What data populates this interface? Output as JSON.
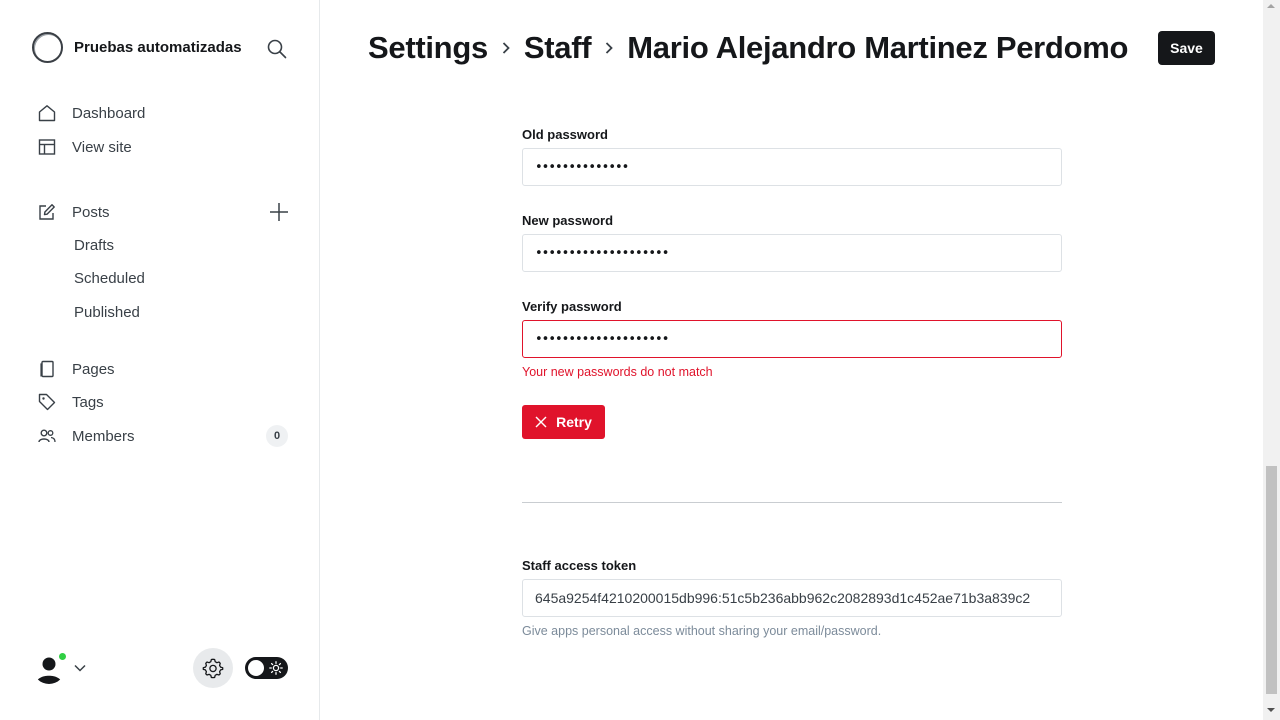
{
  "sidebar": {
    "site_name": "Pruebas automatizadas",
    "nav": {
      "dashboard": "Dashboard",
      "view_site": "View site",
      "posts": "Posts",
      "drafts": "Drafts",
      "scheduled": "Scheduled",
      "published": "Published",
      "pages": "Pages",
      "tags": "Tags",
      "members": "Members",
      "members_count": "0"
    },
    "icons": [
      "search-icon",
      "home-icon",
      "layout-icon",
      "pencil-icon",
      "plus-icon",
      "page-icon",
      "tag-icon",
      "members-icon",
      "gear-icon",
      "sun-icon",
      "chevron-down-icon"
    ]
  },
  "header": {
    "crumbs": [
      "Settings",
      "Staff",
      "Mario Alejandro Martinez Perdomo"
    ],
    "save_label": "Save"
  },
  "password": {
    "old_label": "Old password",
    "old_value": "••••••••••••••",
    "new_label": "New password",
    "new_value": "••••••••••••••••••••",
    "verify_label": "Verify password",
    "verify_value": "••••••••••••••••••••",
    "error": "Your new passwords do not match",
    "retry_label": "Retry"
  },
  "token": {
    "label": "Staff access token",
    "value": "645a9254f4210200015db996:51c5b236abb962c2082893d1c452ae71b3a839c2",
    "hint": "Give apps personal access without sharing your email/password."
  },
  "colors": {
    "accent": "#15171a",
    "error": "#e0132b",
    "online": "#30cf43"
  }
}
